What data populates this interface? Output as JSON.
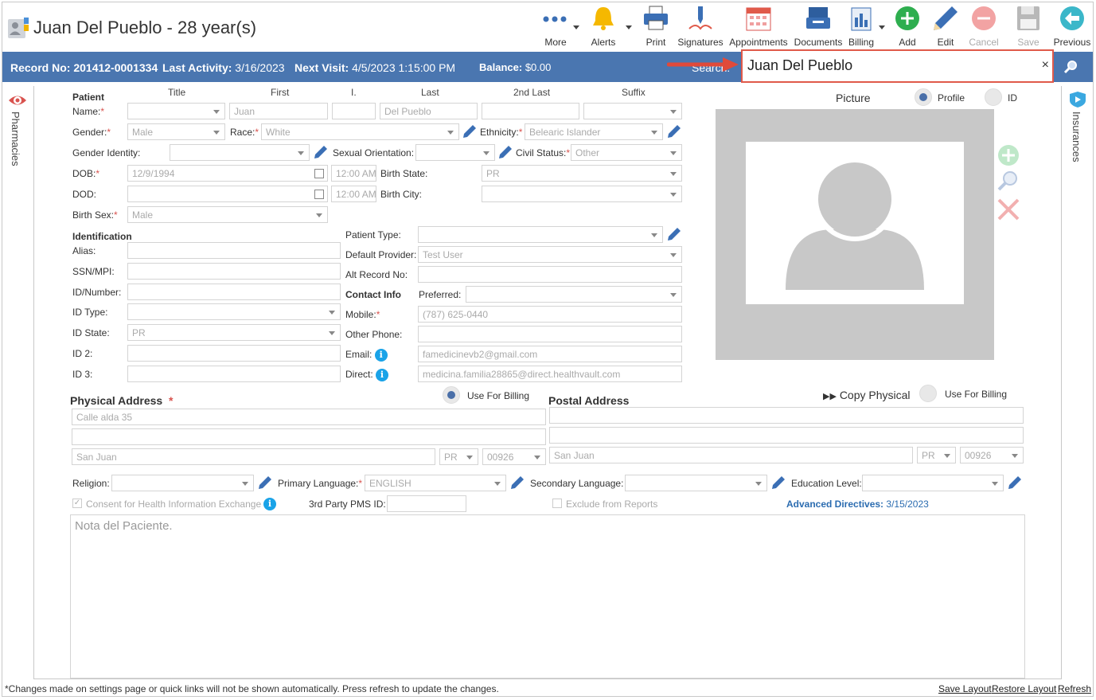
{
  "header": {
    "title": "Juan Del Pueblo - 28 year(s)",
    "toolbar": [
      {
        "id": "more",
        "label": "More",
        "icon": "more-dots-icon"
      },
      {
        "id": "alerts",
        "label": "Alerts",
        "icon": "bell-icon"
      },
      {
        "id": "print",
        "label": "Print",
        "icon": "printer-icon"
      },
      {
        "id": "signatures",
        "label": "Signatures",
        "icon": "signature-pen-icon"
      },
      {
        "id": "appointments",
        "label": "Appointments",
        "icon": "calendar-icon"
      },
      {
        "id": "documents",
        "label": "Documents",
        "icon": "documents-tray-icon"
      },
      {
        "id": "billing",
        "label": "Billing",
        "icon": "billing-icon"
      },
      {
        "id": "add",
        "label": "Add",
        "icon": "plus-circle-icon"
      },
      {
        "id": "edit",
        "label": "Edit",
        "icon": "pencil-icon"
      },
      {
        "id": "cancel",
        "label": "Cancel",
        "icon": "minus-circle-icon"
      },
      {
        "id": "save",
        "label": "Save",
        "icon": "floppy-icon"
      },
      {
        "id": "previous",
        "label": "Previous",
        "icon": "arrow-left-circle-icon"
      }
    ]
  },
  "infobar": {
    "record_label": "Record No:",
    "record_value": "201412-0001334",
    "activity_label": "Last Activity:",
    "activity_value": "3/16/2023",
    "visit_label": "Next Visit:",
    "visit_value": "4/5/2023 1:15:00 PM",
    "balance_label": "Balance:",
    "balance_value": "$0.00",
    "search_label": "Search:",
    "search_value": "Juan Del Pueblo",
    "clear": "×"
  },
  "side": {
    "left_tab": "Pharmacies",
    "right_tab": "Insurances"
  },
  "patient": {
    "section": "Patient",
    "cols": {
      "title": "Title",
      "first": "First",
      "initial": "I.",
      "last": "Last",
      "second_last": "2nd Last",
      "suffix": "Suffix"
    },
    "name_label": "Name:",
    "first": "Juan",
    "last": "Del Pueblo",
    "gender_label": "Gender:",
    "gender": "Male",
    "race_label": "Race:",
    "race": "White",
    "ethnicity_label": "Ethnicity:",
    "ethnicity": "Belearic Islander",
    "gender_identity_label": "Gender Identity:",
    "sexual_orientation_label": "Sexual Orientation:",
    "civil_status_label": "Civil Status:",
    "civil_status": "Other",
    "dob_label": "DOB:",
    "dob": "12/9/1994",
    "dob_time": "12:00 AM",
    "birth_state_label": "Birth State:",
    "birth_state": "PR",
    "dod_label": "DOD:",
    "dod_time": "12:00 AM",
    "birth_city_label": "Birth City:",
    "birth_sex_label": "Birth Sex:",
    "birth_sex": "Male"
  },
  "identification": {
    "section": "Identification",
    "alias_label": "Alias:",
    "ssn_label": "SSN/MPI:",
    "idnum_label": "ID/Number:",
    "idtype_label": "ID Type:",
    "idstate_label": "ID State:",
    "idstate": "PR",
    "id2_label": "ID 2:",
    "id3_label": "ID 3:"
  },
  "details": {
    "patient_type_label": "Patient Type:",
    "provider_label": "Default Provider:",
    "provider": "Test User",
    "alt_record_label": "Alt Record No:",
    "contact_section": "Contact Info",
    "preferred_label": "Preferred:",
    "mobile_label": "Mobile:",
    "mobile": "(787) 625-0440",
    "other_phone_label": "Other Phone:",
    "email_label": "Email:",
    "email": "famedicinevb2@gmail.com",
    "direct_label": "Direct:",
    "direct": "medicina.familia28865@direct.healthvault.com"
  },
  "picture": {
    "title": "Picture",
    "profile_label": "Profile",
    "id_label": "ID"
  },
  "physical": {
    "section": "Physical Address",
    "use_billing": "Use For Billing",
    "line1": "Calle alda 35",
    "city": "San Juan",
    "state": "PR",
    "zip": "00926"
  },
  "postal": {
    "section": "Postal Address",
    "copy": "Copy Physical",
    "use_billing": "Use For Billing",
    "city": "San Juan",
    "state": "PR",
    "zip": "00926"
  },
  "misc": {
    "religion_label": "Religion:",
    "primary_lang_label": "Primary Language:",
    "primary_lang": "ENGLISH",
    "secondary_lang_label": "Secondary Language:",
    "education_label": "Education Level:",
    "consent_label": "Consent for Health Information Exchange",
    "pms_label": "3rd Party PMS ID:",
    "exclude_label": "Exclude from Reports",
    "adv_label": "Advanced Directives:",
    "adv_value": "3/15/2023",
    "note_placeholder": "Nota del Paciente."
  },
  "footer": {
    "notice": "*Changes made on settings page or quick links will not be shown automatically. Press refresh to update the changes.",
    "save_layout": "Save Layout",
    "restore_layout": "Restore Layout",
    "refresh": "Refresh"
  },
  "colors": {
    "infobar": "#4a76b0",
    "accent_red": "#e05a4a",
    "link_blue": "#2b6cb0"
  }
}
